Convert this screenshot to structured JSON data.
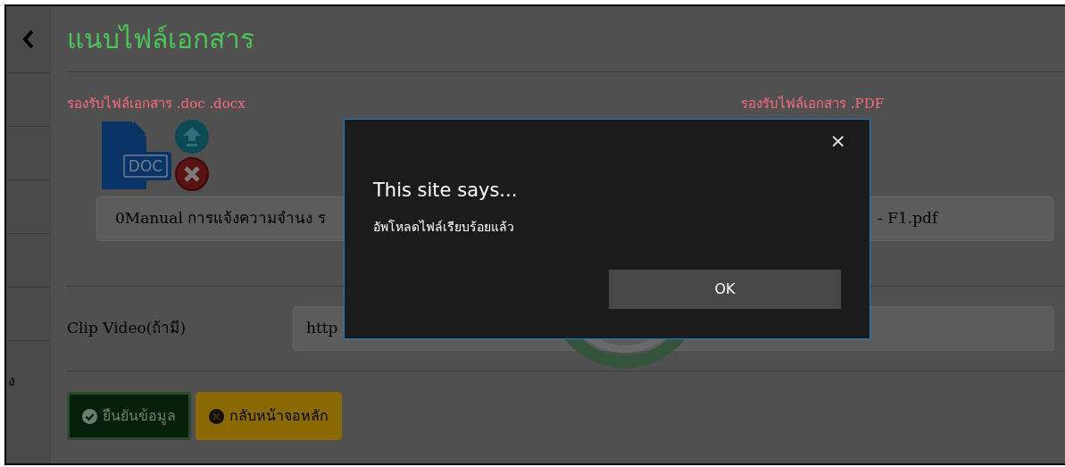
{
  "sidebar": {
    "partial_label": "ง"
  },
  "page": {
    "title": "แนบไฟล์เอกสาร",
    "uploads": [
      {
        "kind": "doc",
        "label": "รองรับไฟล์เอกสาร .doc .docx",
        "icon_text": "DOC",
        "file_name": "0Manual การแจ้งความจำนง ร"
      },
      {
        "kind": "pdf",
        "label": "รองรับไฟล์เอกสาร .PDF",
        "file_name": "- F1.pdf"
      }
    ],
    "video": {
      "label": "Clip Video(ถ้ามี)",
      "value": "http"
    },
    "buttons": [
      {
        "kind": "confirm",
        "label": "ยืนยันข้อมูล"
      },
      {
        "kind": "back",
        "label": "กลับหน้าจอหลัก"
      }
    ]
  },
  "dialog": {
    "title": "This site says...",
    "message": "อัพโหลดไฟล์เรียบร้อยแล้ว",
    "close": "×",
    "ok": "OK"
  }
}
